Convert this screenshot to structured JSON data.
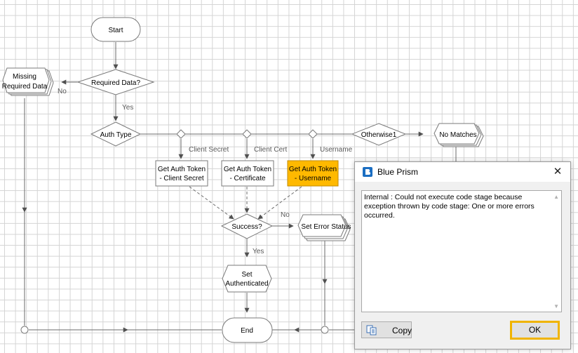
{
  "flowchart": {
    "start": "Start",
    "decision_required": "Required Data?",
    "missing_line1": "Missing",
    "missing_line2": "Required Data",
    "edge_no_1": "No",
    "edge_yes_1": "Yes",
    "choice_auth_type": "Auth Type",
    "choice_client_secret": "Client Secret",
    "choice_client_cert": "Client Cert",
    "choice_username": "Username",
    "otherwise": "Otherwise1",
    "no_matches": "No Matches",
    "action_secret_line1": "Get Auth Token",
    "action_secret_line2": "- Client Secret",
    "action_cert_line1": "Get Auth Token",
    "action_cert_line2": "- Certificate",
    "action_user_line1": "Get Auth Token",
    "action_user_line2": "- Username",
    "decision_success": "Success?",
    "edge_no_2": "No",
    "set_error": "Set Error Status",
    "edge_yes_2": "Yes",
    "set_auth_line1": "Set",
    "set_auth_line2": "Authenticated",
    "end": "End",
    "highlight_color": "#ffb900"
  },
  "dialog": {
    "title": "Blue Prism",
    "close_glyph": "✕",
    "message": "Internal : Could not execute code stage because exception thrown by code stage: One or more errors occurred.",
    "copy_label": "Copy",
    "ok_label": "OK",
    "ok_focus_color": "#f0b400",
    "brand_color": "#1b6ec2",
    "logo_icon": "blue-prism-logo-icon",
    "copy_icon": "copy-document-icon"
  }
}
